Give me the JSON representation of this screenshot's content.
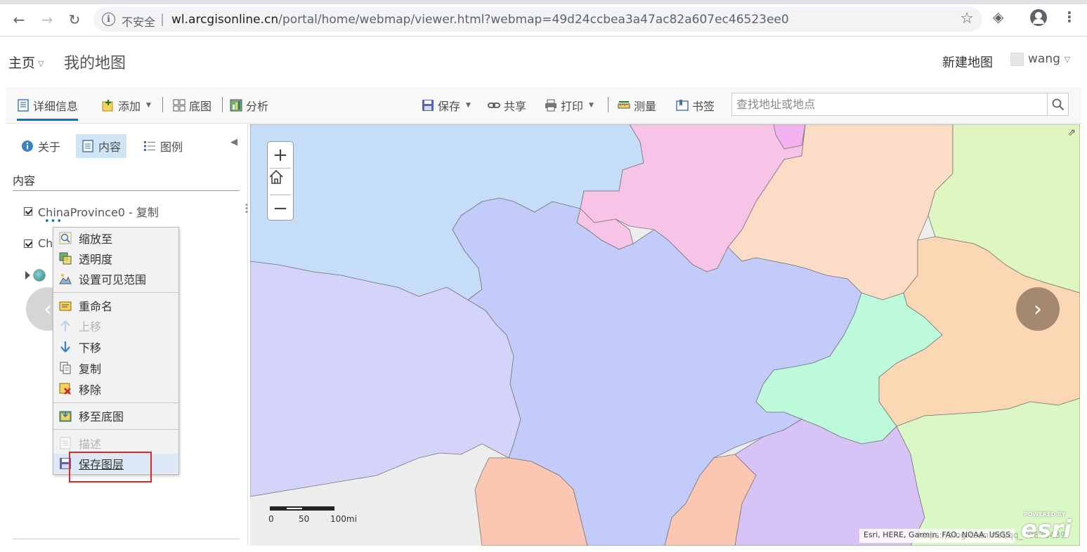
{
  "browser": {
    "security_label": "不安全",
    "url_host": "wl.arcgisonline.cn",
    "url_path": "/portal/home/webmap/viewer.html?webmap=49d24ccbea3a47ac82a607ec46523ee0"
  },
  "header": {
    "home_label": "主页",
    "map_title": "我的地图",
    "new_map_label": "新建地图",
    "username": "wang"
  },
  "toolbar": {
    "details_label": "详细信息",
    "add_label": "添加",
    "basemap_label": "底图",
    "analysis_label": "分析",
    "save_label": "保存",
    "share_label": "共享",
    "print_label": "打印",
    "measure_label": "测量",
    "bookmarks_label": "书签",
    "search_placeholder": "查找地址或地点"
  },
  "panel": {
    "tabs": [
      {
        "label": "关于"
      },
      {
        "label": "内容"
      },
      {
        "label": "图例"
      }
    ],
    "heading": "内容",
    "layers": [
      {
        "name": "ChinaProvince0 - 复制",
        "checked": true
      },
      {
        "name": "Ch",
        "checked": true
      }
    ]
  },
  "context_menu": {
    "items": [
      {
        "label": "缩放至",
        "icon": "zoom-to-icon",
        "disabled": false
      },
      {
        "label": "透明度",
        "icon": "transparency-icon",
        "disabled": false
      },
      {
        "label": "设置可见范围",
        "icon": "visible-range-icon",
        "disabled": false
      },
      {
        "label": "重命名",
        "icon": "rename-icon",
        "disabled": false
      },
      {
        "label": "上移",
        "icon": "move-up-icon",
        "disabled": true
      },
      {
        "label": "下移",
        "icon": "move-down-icon",
        "disabled": false
      },
      {
        "label": "复制",
        "icon": "copy-icon",
        "disabled": false
      },
      {
        "label": "移除",
        "icon": "remove-icon",
        "disabled": false
      },
      {
        "label": "移至底图",
        "icon": "move-to-basemap-icon",
        "disabled": false
      },
      {
        "label": "描述",
        "icon": "description-icon",
        "disabled": true
      },
      {
        "label": "保存图层",
        "icon": "save-layer-icon",
        "disabled": false
      }
    ]
  },
  "map": {
    "scale_labels": [
      "0",
      "50",
      "100mi"
    ],
    "attribution": "Esri, HERE, Garmin, FAO, NOAA, USGS",
    "esri_powered": "POWERED BY",
    "esri_word": "esri",
    "watermark": "https://blog.csdn.net/qq_40676439"
  }
}
